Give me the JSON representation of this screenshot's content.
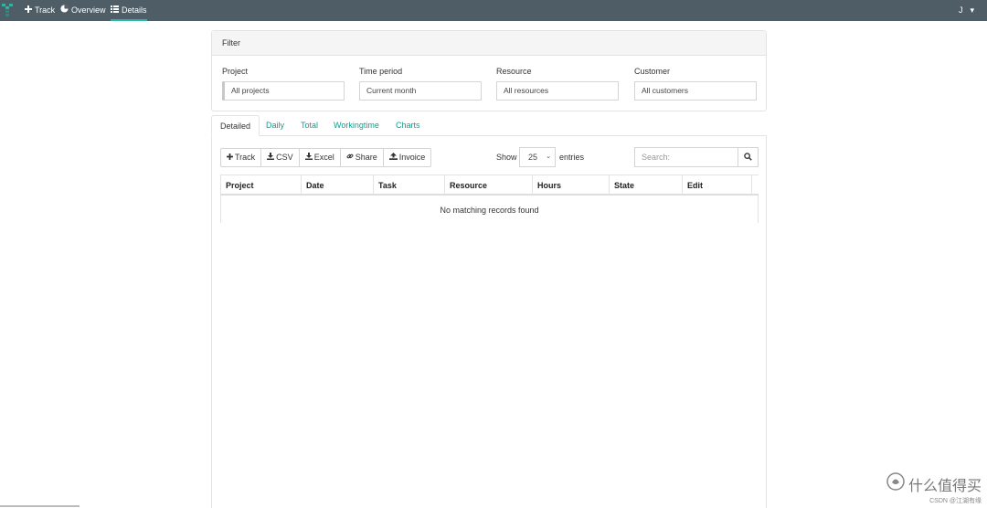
{
  "navbar": {
    "brand_icon": "tracker-logo-icon",
    "items": [
      {
        "label": "Track",
        "icon": "plus-icon"
      },
      {
        "label": "Overview",
        "icon": "pie-chart-icon"
      },
      {
        "label": "Details",
        "icon": "list-icon"
      }
    ],
    "user_initial": "J",
    "accent_color": "#29b6a4",
    "bar_color": "#4f5d67"
  },
  "filter": {
    "title": "Filter",
    "fields": [
      {
        "label": "Project",
        "value": "All projects"
      },
      {
        "label": "Time period",
        "value": "Current month"
      },
      {
        "label": "Resource",
        "value": "All resources"
      },
      {
        "label": "Customer",
        "value": "All customers"
      }
    ]
  },
  "tabs": [
    "Detailed",
    "Daily",
    "Total",
    "Workingtime",
    "Charts"
  ],
  "toolbar": {
    "buttons": [
      {
        "label": "Track",
        "icon": "plus-icon"
      },
      {
        "label": "CSV",
        "icon": "download-icon"
      },
      {
        "label": "Excel",
        "icon": "download-icon"
      },
      {
        "label": "Share",
        "icon": "link-icon"
      },
      {
        "label": "Invoice",
        "icon": "user-upload-icon"
      }
    ],
    "show_label": "Show",
    "page_size": "25",
    "entries_label": "entries",
    "search_placeholder": "Search:"
  },
  "table": {
    "columns": [
      "Project",
      "Date",
      "Task",
      "Resource",
      "Hours",
      "State",
      "Edit"
    ],
    "empty_message": "No matching records found"
  },
  "watermark": {
    "text": "什么值得买",
    "sub": "CSDN @江湖有缘"
  }
}
